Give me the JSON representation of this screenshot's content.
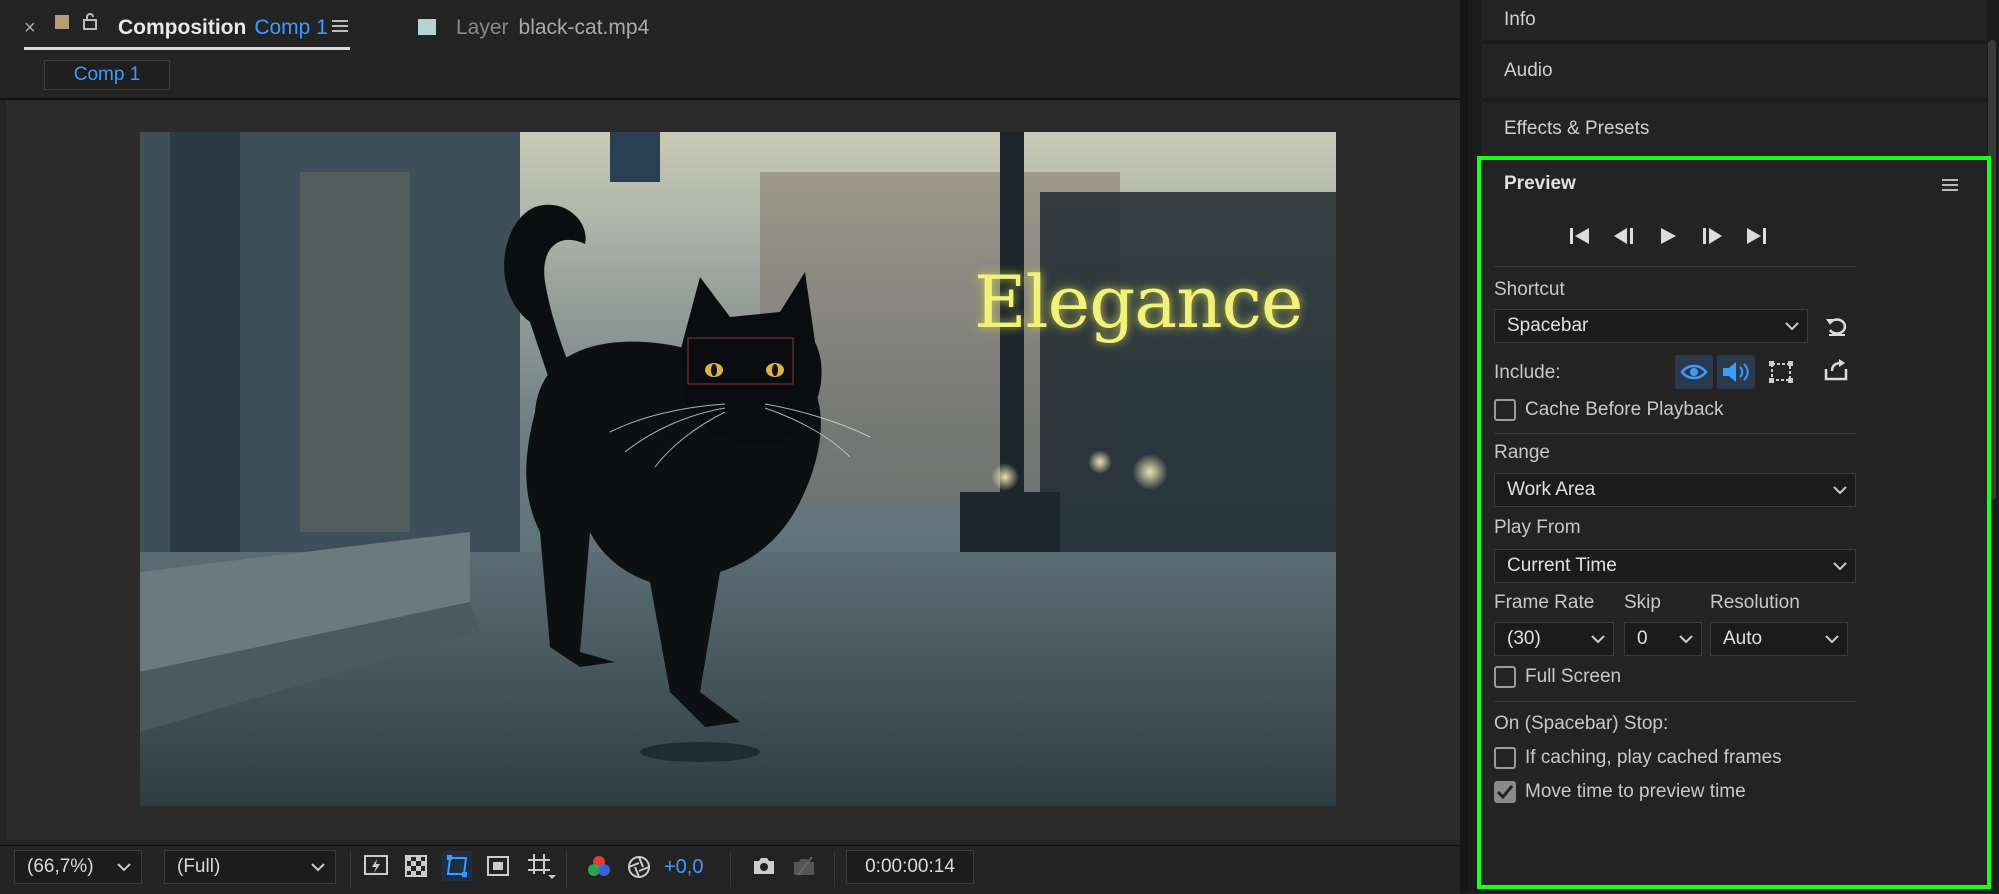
{
  "comp_panel": {
    "close_glyph": "×",
    "tab_title": "Composition",
    "tab_comp_name": "Comp 1",
    "layer_label": "Layer",
    "layer_file": "black-cat.mp4",
    "active_subtab": "Comp 1"
  },
  "viewer": {
    "overlay_title": "Elegance"
  },
  "footer": {
    "zoom": "(66,7%)",
    "resolution": "(Full)",
    "exposure": "+0,0",
    "timecode": "0:00:00:14"
  },
  "right_panels": {
    "info": "Info",
    "audio": "Audio",
    "effects": "Effects & Presets"
  },
  "preview": {
    "title": "Preview",
    "shortcut_label": "Shortcut",
    "shortcut_value": "Spacebar",
    "include_label": "Include:",
    "cache_before": "Cache Before Playback",
    "range_label": "Range",
    "range_value": "Work Area",
    "play_from_label": "Play From",
    "play_from_value": "Current Time",
    "frame_rate_label": "Frame Rate",
    "skip_label": "Skip",
    "resolution_label": "Resolution",
    "frame_rate_value": "(30)",
    "skip_value": "0",
    "resolution_value": "Auto",
    "full_screen": "Full Screen",
    "on_stop_label": "On (Spacebar) Stop:",
    "if_caching": "If caching, play cached frames",
    "move_time": "Move time to preview time",
    "cache_checked": false,
    "full_screen_checked": false,
    "if_caching_checked": false,
    "move_time_checked": true
  },
  "colors": {
    "accent_blue": "#3d9bff",
    "highlight_green": "#1aff1a",
    "title_yellow": "#f2f27a"
  },
  "icons": [
    "close-icon",
    "color-swatch-icon",
    "lock-icon",
    "hamburger-menu-icon",
    "first-frame-icon",
    "prev-frame-icon",
    "play-icon",
    "next-frame-icon",
    "last-frame-icon",
    "reset-icon",
    "eye-icon",
    "speaker-icon",
    "overlay-icon",
    "export-icon",
    "chevron-down-icon",
    "camera-icon",
    "color-channels-icon"
  ]
}
